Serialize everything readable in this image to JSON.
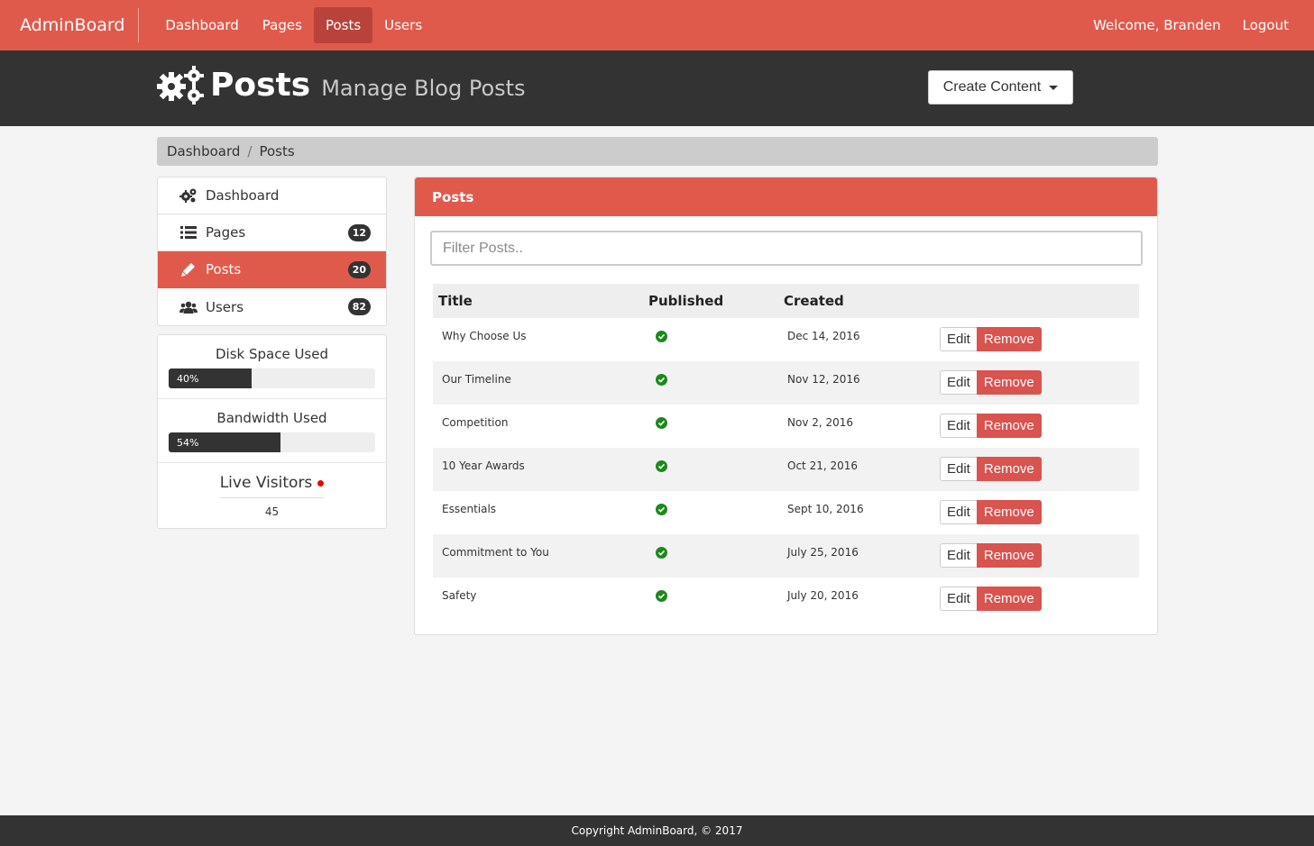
{
  "navbar": {
    "brand": "AdminBoard",
    "links": [
      {
        "label": "Dashboard"
      },
      {
        "label": "Pages"
      },
      {
        "label": "Posts"
      },
      {
        "label": "Users"
      }
    ],
    "active_link": "Posts",
    "welcome": "Welcome, Branden",
    "logout": "Logout"
  },
  "header": {
    "icon": "gears-icon",
    "title": "Posts",
    "subtitle": "Manage Blog Posts",
    "create_button": "Create Content"
  },
  "breadcrumb": {
    "items": [
      "Dashboard",
      "Posts"
    ],
    "separator": "/"
  },
  "sidebar": {
    "items": [
      {
        "label": "Dashboard",
        "icon": "gears-icon",
        "badge": ""
      },
      {
        "label": "Pages",
        "icon": "list-icon",
        "badge": "12"
      },
      {
        "label": "Posts",
        "icon": "pencil-icon",
        "badge": "20"
      },
      {
        "label": "Users",
        "icon": "users-icon",
        "badge": "82"
      }
    ],
    "active_item": "Posts"
  },
  "stats": {
    "disk": {
      "title": "Disk Space Used",
      "percent_label": "40%",
      "value": 40
    },
    "bandwidth": {
      "title": "Bandwidth Used",
      "percent_label": "54%",
      "value": 54
    },
    "live": {
      "title": "Live Visitors",
      "count": "45"
    }
  },
  "panel": {
    "heading": "Posts",
    "filter_placeholder": "Filter Posts..",
    "columns": [
      "Title",
      "Published",
      "Created"
    ],
    "rows": [
      {
        "title": "Why Choose Us",
        "published": true,
        "created": "Dec 14, 2016"
      },
      {
        "title": "Our Timeline",
        "published": true,
        "created": "Nov 12, 2016"
      },
      {
        "title": "Competition",
        "published": true,
        "created": "Nov 2, 2016"
      },
      {
        "title": "10 Year Awards",
        "published": true,
        "created": "Oct 21, 2016"
      },
      {
        "title": "Essentials",
        "published": true,
        "created": "Sept 10, 2016"
      },
      {
        "title": "Commitment to You",
        "published": true,
        "created": "July 25, 2016"
      },
      {
        "title": "Safety",
        "published": true,
        "created": "July 20, 2016"
      }
    ],
    "edit_label": "Edit",
    "remove_label": "Remove"
  },
  "footer": {
    "text": "Copyright AdminBoard, © 2017"
  },
  "colors": {
    "primary": "#e05a4c",
    "dark": "#333333",
    "danger": "#d9534f",
    "success": "#1a8a1a"
  }
}
